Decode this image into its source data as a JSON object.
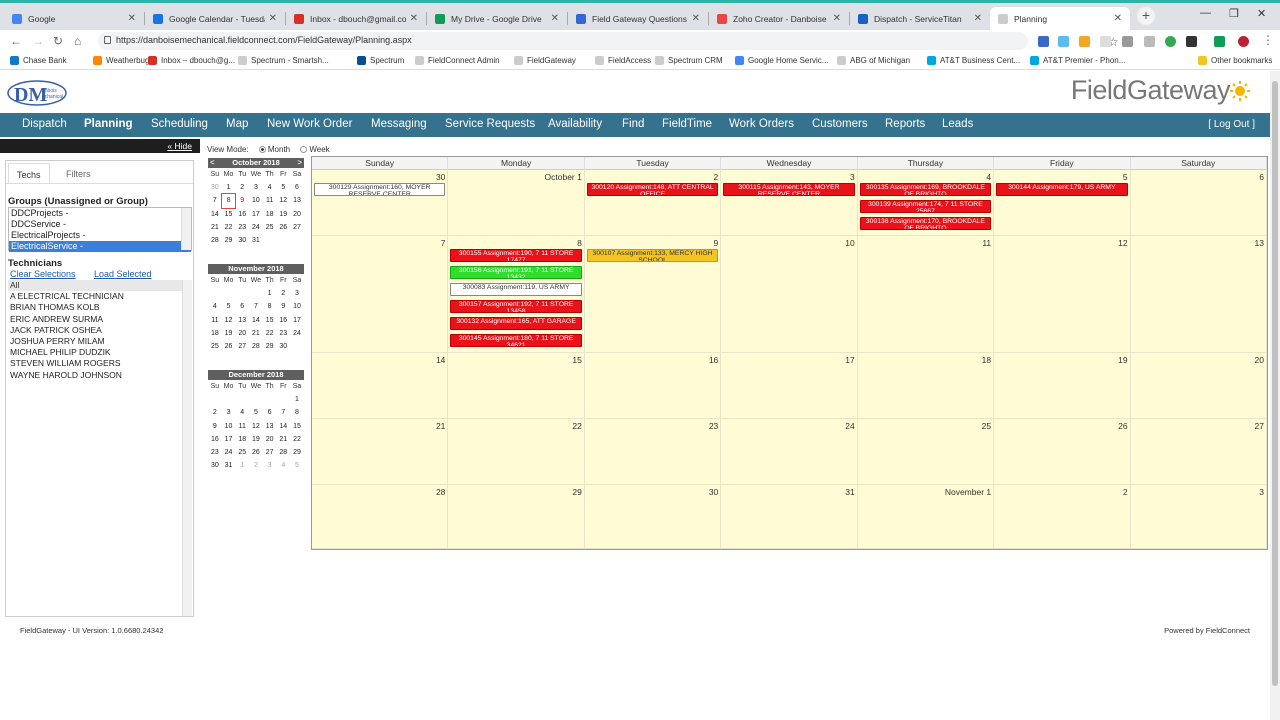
{
  "browser": {
    "tabs": [
      {
        "title": "Google",
        "color": "#4285f4"
      },
      {
        "title": "Google Calendar - Tuesday,",
        "color": "#1a73e8"
      },
      {
        "title": "Inbox - dbouch@gmail.com",
        "color": "#d93025"
      },
      {
        "title": "My Drive - Google Drive",
        "color": "#0f9d58"
      },
      {
        "title": "Field Gateway Questions -",
        "color": "#3367d6"
      },
      {
        "title": "Zoho Creator - Danboise M",
        "color": "#e44"
      },
      {
        "title": "Dispatch - ServiceTitan",
        "color": "#1b61c4"
      },
      {
        "title": "Planning",
        "color": "#ccc"
      }
    ],
    "new_tab_label": "+",
    "url": "https://danboisemechanical.fieldconnect.com/FieldGateway/Planning.aspx",
    "bookmarks": [
      {
        "label": "Chase Bank",
        "color": "#117aca"
      },
      {
        "label": "Weatherbug",
        "color": "#f80"
      },
      {
        "label": "Inbox – dbouch@g...",
        "color": "#d93025"
      },
      {
        "label": "Spectrum - Smartsh...",
        "color": "#ccc"
      },
      {
        "label": "Spectrum",
        "color": "#0a4d92"
      },
      {
        "label": "FieldConnect Admin",
        "color": "#ccc"
      },
      {
        "label": "FieldGateway",
        "color": "#ccc"
      },
      {
        "label": "FieldAccess",
        "color": "#ccc"
      },
      {
        "label": "Spectrum CRM",
        "color": "#ccc"
      },
      {
        "label": "Google Home Servic...",
        "color": "#4285f4"
      },
      {
        "label": "ABG of Michigan",
        "color": "#ccc"
      },
      {
        "label": "AT&T Business Cent...",
        "color": "#00a8e0"
      },
      {
        "label": "AT&T Premier - Phon...",
        "color": "#00a8e0"
      },
      {
        "label": "Other bookmarks",
        "color": "#f3c524"
      }
    ]
  },
  "app": {
    "brand": "FieldGateway",
    "logo_text": "Danbois Mechanical Inc.",
    "nav": [
      "Dispatch",
      "Planning",
      "Scheduling",
      "Map",
      "New Work Order",
      "Messaging",
      "Service Requests",
      "Availability",
      "Find",
      "FieldTime",
      "Work Orders",
      "Customers",
      "Reports",
      "Leads"
    ],
    "active_nav": "Planning",
    "logout": "[ Log Out ]",
    "hide": "« Hide"
  },
  "left_panel": {
    "tab_techs": "Techs",
    "tab_filters": "Filters",
    "groups_title": "Groups (Unassigned or Group)",
    "groups": [
      "DDCProjects -",
      "DDCService -",
      "ElectricalProjects -",
      "ElectricalService -"
    ],
    "selected_group": "ElectricalService -",
    "technicians_title": "Technicians",
    "clear_selections": "Clear Selections",
    "load_selected": "Load Selected",
    "technicians": [
      "All",
      "A ELECTRICAL TECHNICIAN",
      "BRIAN THOMAS KOLB",
      "ERIC ANDREW SURMA",
      "JACK PATRICK OSHEA",
      "JOSHUA PERRY MILAM",
      "MICHAEL PHILIP DUDZIK",
      "STEVEN WILLIAM ROGERS",
      "WAYNE HAROLD JOHNSON"
    ]
  },
  "view_mode": {
    "label": "View Mode:",
    "month": "Month",
    "week": "Week",
    "selected": "Month"
  },
  "mini_calendars": [
    {
      "title": "October 2018",
      "arrows": [
        "<",
        ">"
      ],
      "days": [
        "30",
        "1",
        "2",
        "3",
        "4",
        "5",
        "6",
        "7",
        "8",
        "9",
        "10",
        "11",
        "12",
        "13",
        "14",
        "15",
        "16",
        "17",
        "18",
        "19",
        "20",
        "21",
        "22",
        "23",
        "24",
        "25",
        "26",
        "27",
        "28",
        "29",
        "30",
        "31",
        "",
        "",
        ""
      ],
      "other_month": [
        0
      ],
      "today": 8
    },
    {
      "title": "November 2018",
      "arrows": [],
      "days": [
        "",
        "",
        "",
        "",
        "1",
        "2",
        "3",
        "4",
        "5",
        "6",
        "7",
        "8",
        "9",
        "10",
        "11",
        "12",
        "13",
        "14",
        "15",
        "16",
        "17",
        "18",
        "19",
        "20",
        "21",
        "22",
        "23",
        "24",
        "25",
        "26",
        "27",
        "28",
        "29",
        "30",
        ""
      ],
      "other_month": [],
      "today": -1
    },
    {
      "title": "December 2018",
      "arrows": [],
      "days": [
        "",
        "",
        "",
        "",
        "",
        "",
        "1",
        "2",
        "3",
        "4",
        "5",
        "6",
        "7",
        "8",
        "9",
        "10",
        "11",
        "12",
        "13",
        "14",
        "15",
        "16",
        "17",
        "18",
        "19",
        "20",
        "21",
        "22",
        "23",
        "24",
        "25",
        "26",
        "27",
        "28",
        "29",
        "30",
        "31",
        "1",
        "2",
        "3",
        "4",
        "5"
      ],
      "other_month": [
        37,
        38,
        39,
        40,
        41
      ],
      "today": -1
    }
  ],
  "mini_dow": [
    "Su",
    "Mo",
    "Tu",
    "We",
    "Th",
    "Fr",
    "Sa"
  ],
  "calendar": {
    "weekdays": [
      "Sunday",
      "Monday",
      "Tuesday",
      "Wednesday",
      "Thursday",
      "Friday",
      "Saturday"
    ],
    "weeks": [
      {
        "days": [
          {
            "n": "30",
            "events": [
              {
                "text": "300129 Assignment:160, MOYER RESERVE CENTER",
                "c": "white"
              }
            ]
          },
          {
            "n": "October 1",
            "events": []
          },
          {
            "n": "2",
            "events": [
              {
                "text": "300120 Assignment:148, ATT CENTRAL OFFICE",
                "c": "red"
              }
            ]
          },
          {
            "n": "3",
            "events": [
              {
                "text": "300115 Assignment:143, MOYER RESERVE CENTER",
                "c": "red"
              }
            ]
          },
          {
            "n": "4",
            "events": [
              {
                "text": "300135 Assignment:169, BROOKDALE OF BRIGHTO",
                "c": "red"
              },
              {
                "text": "300139 Assignment:174, 7 11 STORE 25667",
                "c": "red"
              },
              {
                "text": "300136 Assignment:170, BROOKDALE OF BRIGHTO",
                "c": "red"
              }
            ]
          },
          {
            "n": "5",
            "events": [
              {
                "text": "300144 Assignment:179, US ARMY",
                "c": "red"
              }
            ]
          },
          {
            "n": "6",
            "events": []
          }
        ]
      },
      {
        "days": [
          {
            "n": "7",
            "events": []
          },
          {
            "n": "8",
            "events": [
              {
                "text": "300155 Assignment:190, 7 11 STORE 17477",
                "c": "red"
              },
              {
                "text": "300156 Assignment:191, 7 11 STORE 13432",
                "c": "green"
              },
              {
                "text": "300083 Assignment:119, US ARMY",
                "c": "white"
              },
              {
                "text": "300157 Assignment:192, 7 11 STORE 13458",
                "c": "red"
              },
              {
                "text": "300132 Assignment:165, ATT GARAGE",
                "c": "red"
              },
              {
                "text": "300145 Assignment:180, 7 11 STORE 34621",
                "c": "red"
              }
            ]
          },
          {
            "n": "9",
            "events": [
              {
                "text": "300107 Assignment:133, MERCY HIGH SCHOOL",
                "c": "yellow"
              }
            ]
          },
          {
            "n": "10",
            "events": []
          },
          {
            "n": "11",
            "events": []
          },
          {
            "n": "12",
            "events": []
          },
          {
            "n": "13",
            "events": []
          }
        ]
      },
      {
        "days": [
          {
            "n": "14",
            "events": []
          },
          {
            "n": "15",
            "events": []
          },
          {
            "n": "16",
            "events": []
          },
          {
            "n": "17",
            "events": []
          },
          {
            "n": "18",
            "events": []
          },
          {
            "n": "19",
            "events": []
          },
          {
            "n": "20",
            "events": []
          }
        ]
      },
      {
        "days": [
          {
            "n": "21",
            "events": []
          },
          {
            "n": "22",
            "events": []
          },
          {
            "n": "23",
            "events": []
          },
          {
            "n": "24",
            "events": []
          },
          {
            "n": "25",
            "events": []
          },
          {
            "n": "26",
            "events": []
          },
          {
            "n": "27",
            "events": []
          }
        ]
      },
      {
        "days": [
          {
            "n": "28",
            "events": []
          },
          {
            "n": "29",
            "events": []
          },
          {
            "n": "30",
            "events": []
          },
          {
            "n": "31",
            "events": []
          },
          {
            "n": "November 1",
            "events": []
          },
          {
            "n": "2",
            "events": []
          },
          {
            "n": "3",
            "events": []
          }
        ]
      }
    ]
  },
  "footer": {
    "version": "FieldGateway - UI Version: 1.0.6680.24342",
    "powered": "Powered by FieldConnect"
  }
}
